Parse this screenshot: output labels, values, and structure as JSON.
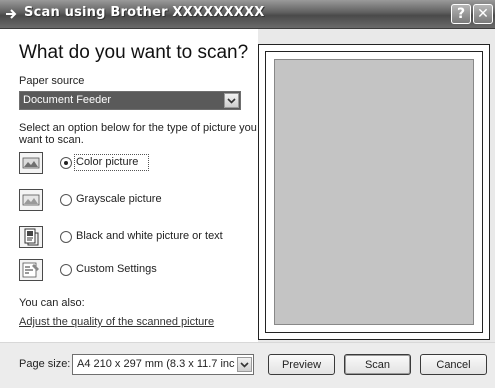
{
  "window": {
    "title": "Scan using Brother XXXXXXXXX",
    "help_glyph": "?",
    "close_glyph": "✕"
  },
  "main": {
    "heading": "What do you want to scan?",
    "paper_source": {
      "label": "Paper source",
      "selected": "Document Feeder"
    },
    "instruction_line1": "Select an option below for the type of picture you",
    "instruction_line2": "want to scan.",
    "options": [
      {
        "label": "Color picture",
        "icon": "color-picture-icon",
        "checked": true
      },
      {
        "label": "Grayscale picture",
        "icon": "grayscale-picture-icon",
        "checked": false
      },
      {
        "label": "Black and white picture or text",
        "icon": "black-white-text-icon",
        "checked": false
      },
      {
        "label": "Custom Settings",
        "icon": "custom-settings-icon",
        "checked": false
      }
    ],
    "also_label": "You can also:",
    "adjust_link": "Adjust the quality of the scanned picture"
  },
  "footer": {
    "page_size_label": "Page size:",
    "page_size_value": "A4 210 x 297 mm (8.3 x 11.7 inc",
    "preview_button": "Preview",
    "scan_button": "Scan",
    "cancel_button": "Cancel"
  }
}
